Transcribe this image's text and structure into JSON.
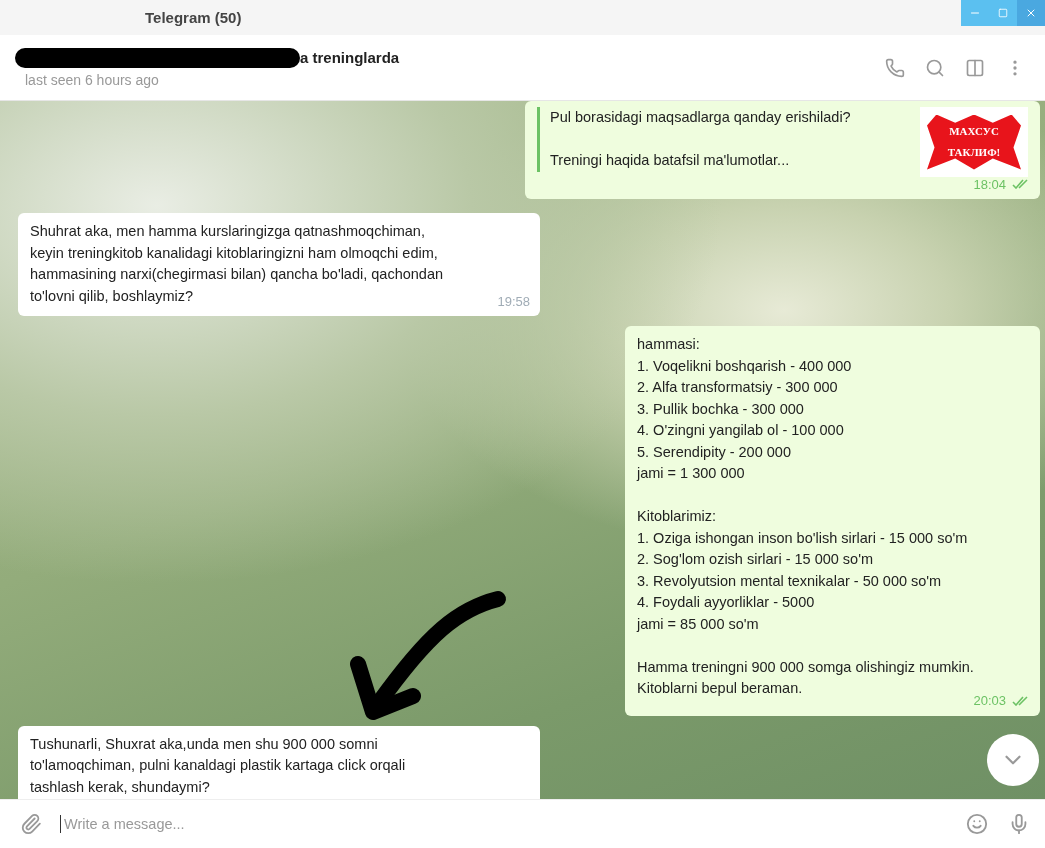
{
  "window": {
    "title": "Telegram (50)"
  },
  "chat": {
    "title": "a treninglarda",
    "status": "last seen 6 hours ago"
  },
  "messages": [
    {
      "kind": "preview",
      "lines": [
        "Pul borasidagi maqsadlarga qanday erishiladi?",
        "Treningi haqida batafsil ma'lumotlar..."
      ],
      "image_text": "МАХСУС ТАКЛИФ!",
      "time": "18:04",
      "read": true
    },
    {
      "kind": "incoming",
      "text": "Shuhrat aka, men hamma kurslaringizga qatnashmoqchiman,\nkeyin treningkitob kanalidagi kitoblaringizni ham olmoqchi edim,\nhammasining narxi(chegirmasi bilan) qancha bo'ladi, qachondan\nto'lovni qilib, boshlaymiz?",
      "time": "19:58"
    },
    {
      "kind": "outgoing",
      "text": "hammasi:\n1. Voqelikni boshqarish - 400 000\n2. Alfa transformatsiy - 300 000\n3. Pullik bochka - 300 000\n4. O'zingni yangilab ol - 100 000\n5. Serendipity - 200 000\njami = 1 300 000\n\nKitoblarimiz:\n1. Oziga ishongan inson bo'lish sirlari - 15 000 so'm\n2. Sog'lom ozish sirlari - 15 000 so'm\n3. Revolyutsion mental texnikalar - 50 000 so'm\n4. Foydali ayyorliklar - 5000\njami = 85 000 so'm\n\nHamma treningni 900 000 somga olishingiz mumkin.\nKitoblarni bepul beraman.",
      "time": "20:03",
      "read": true
    },
    {
      "kind": "incoming",
      "text": "Tushunarli, Shuxrat aka,unda men shu 900 000 somni\nto'lamoqchiman, pulni kanaldagi plastik kartaga click orqali\ntashlash kerak, shundaymi?"
    }
  ],
  "composer": {
    "placeholder": "Write a message..."
  }
}
